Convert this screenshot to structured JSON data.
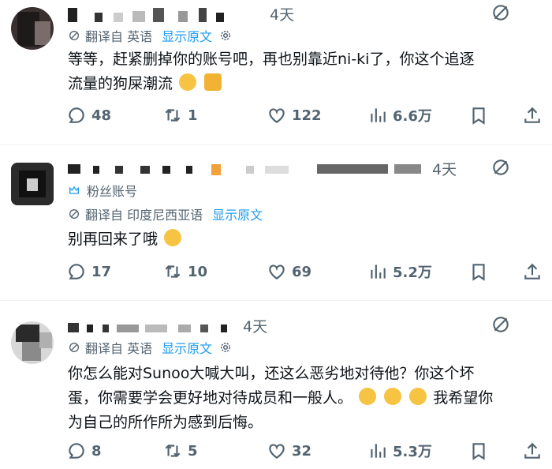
{
  "tweets": [
    {
      "time": "4天",
      "translate_label": "翻译自 英语",
      "show_original": "显示原文",
      "line1": "等等，赶紧删掉你的账号吧，再也别靠近ni-ki了，你这个追逐",
      "line2": "流量的狗屎潮流",
      "emoji_tail": "😹🙏",
      "stats": {
        "replies": "48",
        "retweets": "1",
        "likes": "122",
        "views": "6.6万"
      }
    },
    {
      "time": "4天",
      "fan_label": "粉丝账号",
      "translate_label": "翻译自 印度尼西亚语",
      "show_original": "显示原文",
      "line1": "别再回来了哦",
      "stats": {
        "replies": "17",
        "retweets": "10",
        "likes": "69",
        "views": "5.2万"
      }
    },
    {
      "time": "4天",
      "translate_label": "翻译自 英语",
      "show_original": "显示原文",
      "line1": "你怎么能对Sunoo大喊大叫，还这么恶劣地对待他？你这个坏",
      "line2": "蛋，你需要学会更好地对待成员和一般人。",
      "line2_tail": "我希望你",
      "line3": "为自己的所作所为感到后悔。",
      "stats": {
        "replies": "8",
        "retweets": "5",
        "likes": "32",
        "views": "5.3万"
      }
    }
  ],
  "colors": {
    "text": "#0f1419",
    "muted": "#536471",
    "link": "#1d9bf0",
    "divider": "#eff3f4"
  }
}
